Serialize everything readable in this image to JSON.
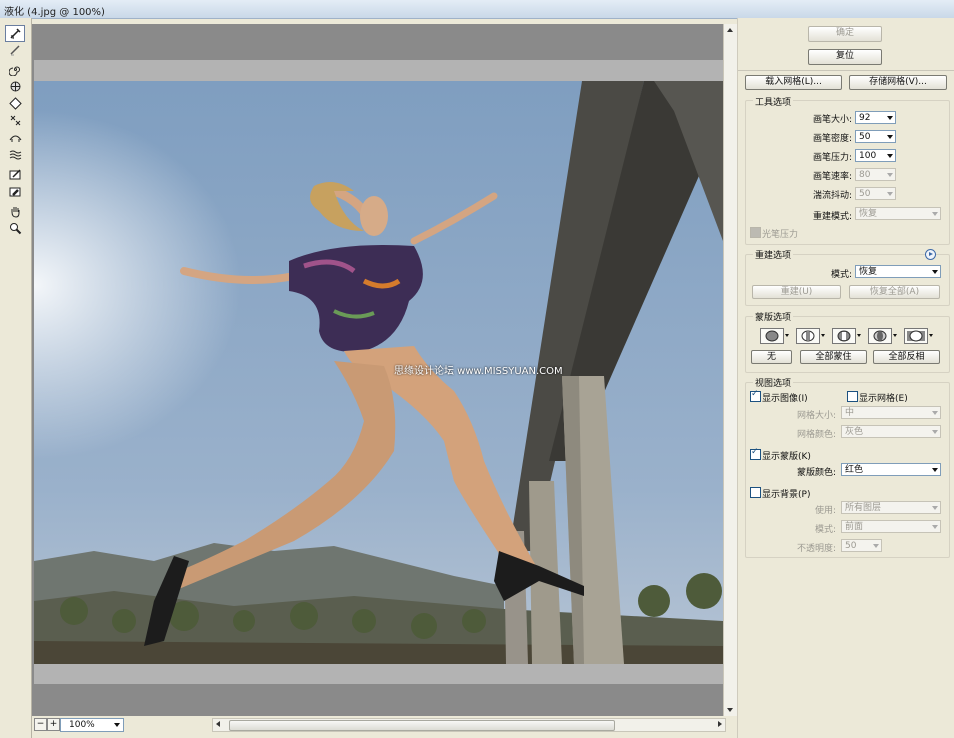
{
  "window": {
    "title": "液化 (4.jpg @ 100%)"
  },
  "tools": [
    "warp-icon",
    "reconstruct-icon",
    "twirl-icon",
    "pucker-icon",
    "bloat-icon",
    "push-left-icon",
    "mirror-icon",
    "turbulence-icon",
    "freeze-mask-icon",
    "thaw-mask-icon",
    "hand-icon",
    "zoom-icon"
  ],
  "canvas": {
    "watermark": "思缘设计论坛 www.MISSYUAN.COM",
    "zoom": "100%"
  },
  "panel": {
    "ok": "确定",
    "reset": "复位",
    "load_mesh": "载入网格(L)...",
    "save_mesh": "存储网格(V)...",
    "tool_options": {
      "title": "工具选项",
      "brush_size": {
        "label": "画笔大小:",
        "value": "92"
      },
      "brush_density": {
        "label": "画笔密度:",
        "value": "50"
      },
      "brush_pressure": {
        "label": "画笔压力:",
        "value": "100"
      },
      "brush_rate": {
        "label": "画笔速率:",
        "value": "80"
      },
      "turbulent_jitter": {
        "label": "湍流抖动:",
        "value": "50"
      },
      "reconstruct_mode": {
        "label": "重建模式:",
        "value": "恢复"
      },
      "stylus_pressure": "光笔压力"
    },
    "reconstruct_options": {
      "title": "重建选项",
      "mode": {
        "label": "模式:",
        "value": "恢复"
      },
      "reconstruct": "重建(U)",
      "restore_all": "恢复全部(A)"
    },
    "mask_options": {
      "title": "蒙版选项",
      "none": "无",
      "mask_all": "全部蒙住",
      "invert_all": "全部反相"
    },
    "view_options": {
      "title": "视图选项",
      "show_image": "显示图像(I)",
      "show_mesh": "显示网格(E)",
      "mesh_size": {
        "label": "网格大小:",
        "value": "中"
      },
      "mesh_color": {
        "label": "网格颜色:",
        "value": "灰色"
      },
      "show_mask": "显示蒙版(K)",
      "mask_color": {
        "label": "蒙版颜色:",
        "value": "红色"
      },
      "show_backdrop": "显示背景(P)",
      "use": {
        "label": "使用:",
        "value": "所有图层"
      },
      "mode": {
        "label": "模式:",
        "value": "前面"
      },
      "opacity": {
        "label": "不透明度:",
        "value": "50"
      }
    }
  }
}
